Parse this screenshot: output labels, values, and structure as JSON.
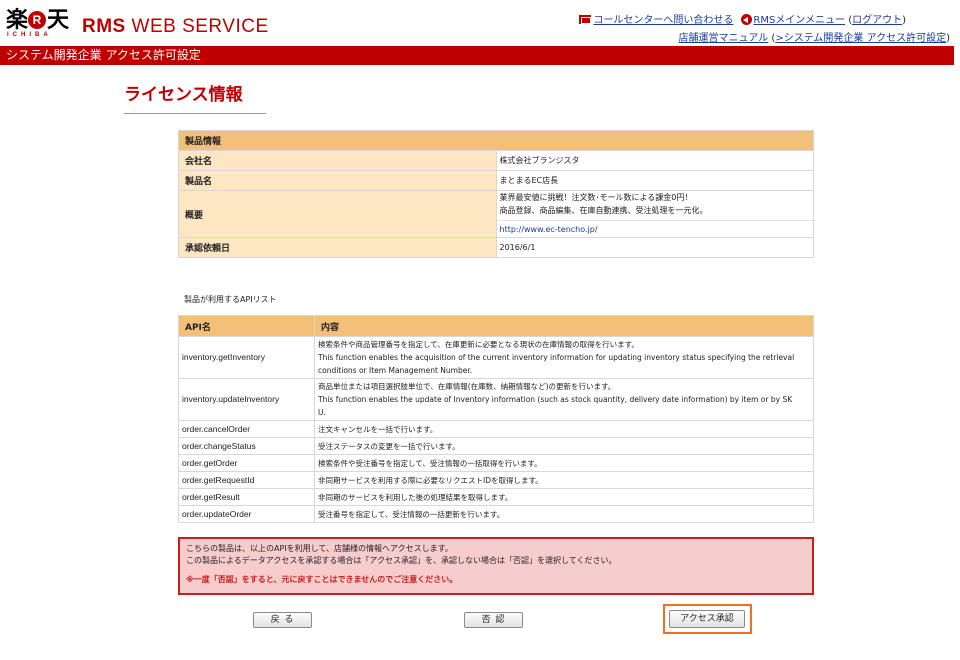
{
  "header": {
    "logo_main": [
      "楽",
      "R",
      "天"
    ],
    "logo_sub": "ICHIBA",
    "brand_bold": "RMS",
    "brand_rest": "WEB SERVICE",
    "links": {
      "contact": "コールセンターへ問い合わせる",
      "rms_menu": "RMSメインメニュー",
      "logout_open": "(",
      "logout": "ログアウト",
      "logout_close": ")",
      "manual": "店舗運営マニュアル",
      "dev_open": "(",
      "dev_access": ">システム開発企業 アクセス許可設定",
      "dev_close": ")"
    },
    "section_bar": "システム開発企業 アクセス許可設定"
  },
  "page_title": "ライセンス情報",
  "product": {
    "header": "製品情報",
    "company_label": "会社名",
    "company_value": "株式会社ブランジスタ",
    "product_label": "製品名",
    "product_value": "まとまるEC店長",
    "summary_label": "概要",
    "summary_line1": "業界最安値に挑戦！注文数･モール数による課金0円！",
    "summary_line2": "商品登録、商品編集、在庫自動連携、受注処理を一元化。",
    "summary_url": "http://www.ec-tencho.jp/",
    "date_label": "承認依頼日",
    "date_value": "2016/6/1"
  },
  "api_list": {
    "caption": "製品が利用するAPIリスト",
    "col_name": "API名",
    "col_desc": "内容",
    "rows": [
      {
        "name": "inventory.getInventory",
        "desc": [
          "検索条件や商品管理番号を指定して、在庫更新に必要となる現状の在庫情報の取得を行います。",
          "This function enables the acquisition of the current inventory information for updating inventory status specifying the retrieval",
          "conditions or Item Management Number."
        ]
      },
      {
        "name": "inventory.updateInventory",
        "desc": [
          "商品単位または項目選択肢単位で、在庫情報(在庫数、納期情報など)の更新を行います。",
          "This function enables the update of Inventory information (such as stock quantity, delivery date information) by item or by SK",
          "U."
        ]
      },
      {
        "name": "order.cancelOrder",
        "desc": [
          "注文キャンセルを一括で行います。"
        ]
      },
      {
        "name": "order.changeStatus",
        "desc": [
          "受注ステータスの変更を一括で行います。"
        ]
      },
      {
        "name": "order.getOrder",
        "desc": [
          "検索条件や受注番号を指定して、受注情報の一括取得を行います。"
        ]
      },
      {
        "name": "order.getRequestId",
        "desc": [
          "非同期サービスを利用する際に必要なリクエストIDを取得します。"
        ]
      },
      {
        "name": "order.getResult",
        "desc": [
          "非同期のサービスを利用した後の処理結果を取得します。"
        ]
      },
      {
        "name": "order.updateOrder",
        "desc": [
          "受注番号を指定して、受注情報の一括更新を行います。"
        ]
      }
    ]
  },
  "notice": {
    "line1": "こちらの製品は、以上のAPIを利用して、店舗様の情報へアクセスします。",
    "line2": "この製品によるデータアクセスを承認する場合は「アクセス承認」を、承認しない場合は「否認」を選択してください。",
    "warning": "※一度「否認」をすると、元に戻すことはできませんのでご注意ください。"
  },
  "buttons": {
    "back": "戻 る",
    "deny": "否 認",
    "approve": "アクセス承認"
  },
  "colors": {
    "brand_red": "#bf0000",
    "table_header": "#f4c079",
    "table_label": "#fde7c2",
    "notice_bg": "#f7cccc",
    "highlight": "#f26f21"
  }
}
